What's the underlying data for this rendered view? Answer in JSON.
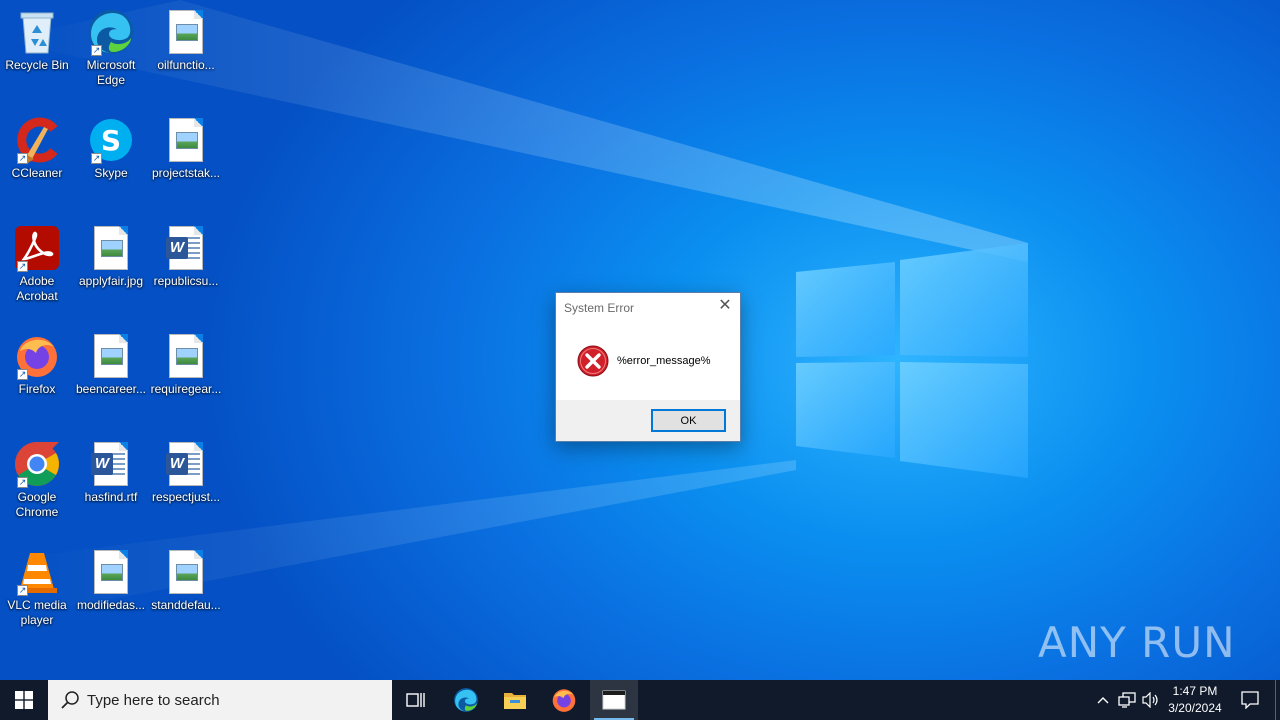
{
  "desktop": {
    "icons": [
      {
        "label": "Recycle Bin",
        "icon": "recycle-bin-icon"
      },
      {
        "label": "Microsoft Edge",
        "icon": "edge-icon"
      },
      {
        "label": "oilfunctio...",
        "icon": "image-file-icon"
      },
      {
        "label": "CCleaner",
        "icon": "ccleaner-icon"
      },
      {
        "label": "Skype",
        "icon": "skype-icon"
      },
      {
        "label": "projectstak...",
        "icon": "image-file-icon"
      },
      {
        "label": "Adobe Acrobat",
        "icon": "acrobat-icon"
      },
      {
        "label": "applyfair.jpg",
        "icon": "image-file-icon"
      },
      {
        "label": "republicsu...",
        "icon": "word-doc-icon"
      },
      {
        "label": "Firefox",
        "icon": "firefox-icon"
      },
      {
        "label": "beencareer...",
        "icon": "image-file-icon"
      },
      {
        "label": "requiregear...",
        "icon": "image-file-icon"
      },
      {
        "label": "Google Chrome",
        "icon": "chrome-icon"
      },
      {
        "label": "hasfind.rtf",
        "icon": "word-doc-icon"
      },
      {
        "label": "respectjust...",
        "icon": "word-doc-icon"
      },
      {
        "label": "VLC media player",
        "icon": "vlc-icon"
      },
      {
        "label": "modifiedas...",
        "icon": "image-file-icon"
      },
      {
        "label": "standdefau...",
        "icon": "image-file-icon"
      }
    ]
  },
  "dialog": {
    "title": "System Error",
    "close_glyph": "✕",
    "message": "%error_message%",
    "ok_label": "OK",
    "icon": "error-icon"
  },
  "watermark": {
    "text": "ANY RUN"
  },
  "taskbar": {
    "search_placeholder": "Type here to search",
    "pinned": [
      "task-view-icon",
      "edge-icon",
      "file-explorer-icon",
      "firefox-icon",
      "window-app-icon"
    ],
    "clock_time": "1:47 PM",
    "clock_date": "3/20/2024"
  },
  "colors": {
    "taskbar": "#101a2a",
    "accent": "#0078d7",
    "error_red": "#d0202a"
  }
}
